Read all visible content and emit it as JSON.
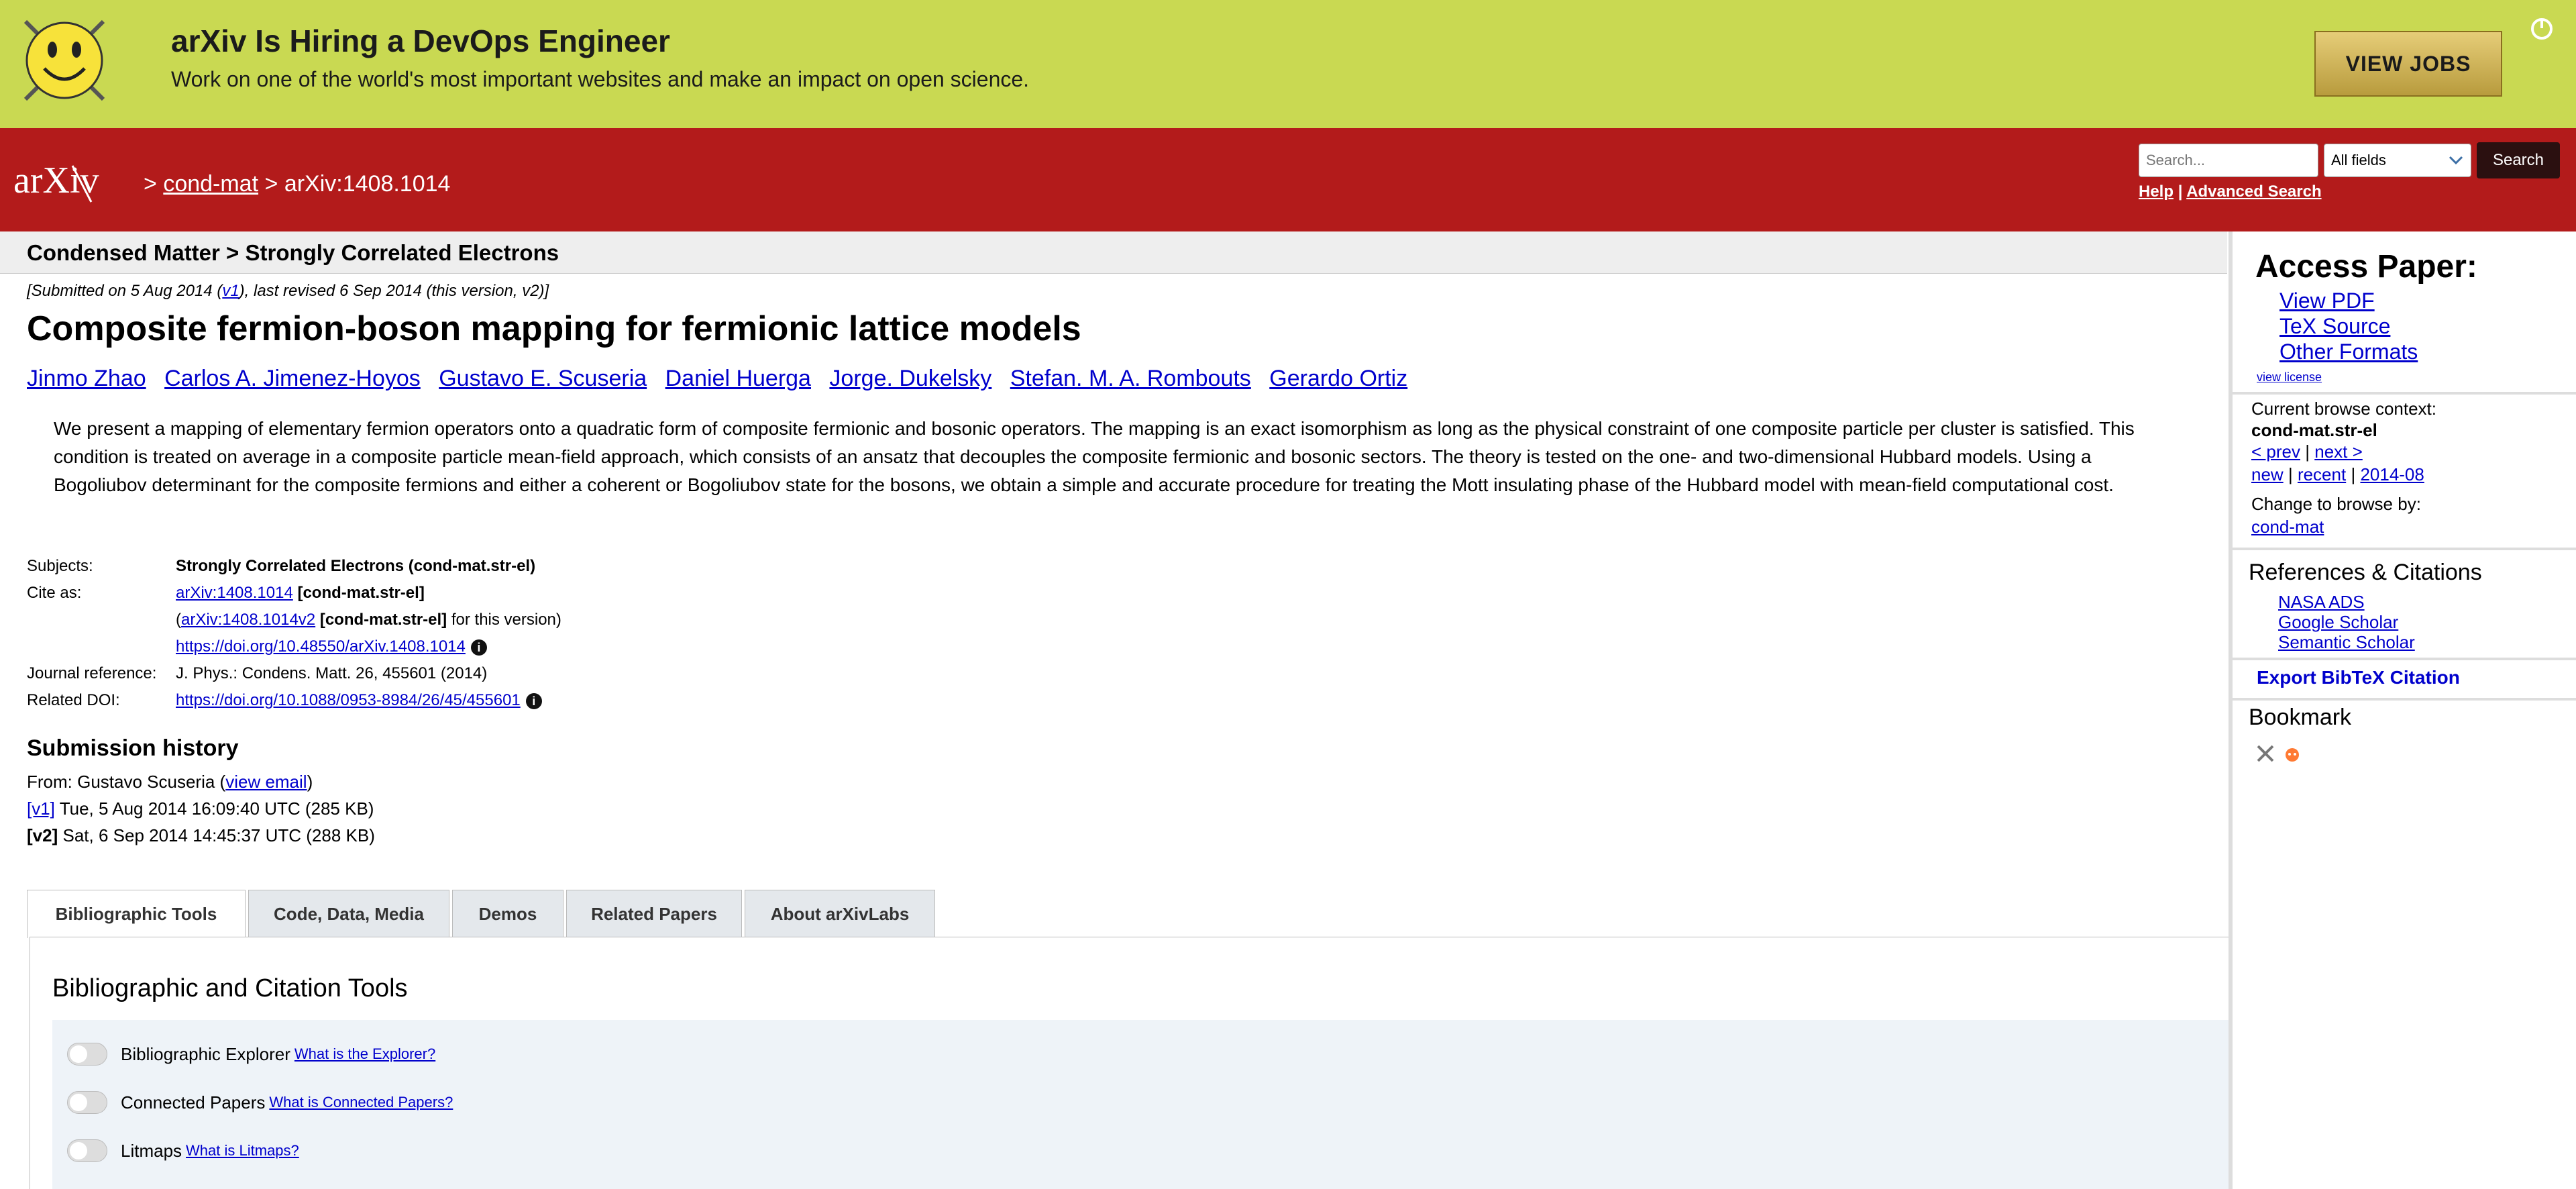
{
  "banner": {
    "title": "arXiv Is Hiring a DevOps Engineer",
    "subtitle": "Work on one of the world's most important websites and make an impact on open science.",
    "cta_label": "VIEW JOBS",
    "colors": {
      "background": "#c9d952",
      "button": "#d2b45a"
    }
  },
  "header": {
    "logo_text": "arXiv",
    "breadcrumb_sep": ">",
    "breadcrumb_category": "cond-mat",
    "breadcrumb_id": "arXiv:1408.1014",
    "search_placeholder": "Search...",
    "search_field_selected": "All fields",
    "search_button": "Search",
    "help_label": "Help",
    "help_sep": "|",
    "advanced_label": "Advanced Search",
    "colors": {
      "background": "#b31b1b"
    }
  },
  "paper": {
    "subject_header": "Condensed Matter > Strongly Correlated Electrons",
    "dateline_prefix": "[Submitted on 5 Aug 2014 (",
    "dateline_version": "v1",
    "dateline_suffix": "), last revised 6 Sep 2014 (this version, v2)]",
    "title": "Composite fermion-boson mapping for fermionic lattice models",
    "authors": [
      "Jinmo Zhao",
      "Carlos A. Jimenez-Hoyos",
      "Gustavo E. Scuseria",
      "Daniel Huerga",
      "Jorge. Dukelsky",
      "Stefan. M. A. Rombouts",
      "Gerardo Ortiz"
    ],
    "abstract": "We present a mapping of elementary fermion operators onto a quadratic form of composite fermionic and bosonic operators. The mapping is an exact isomorphism as long as the physical constraint of one composite particle per cluster is satisfied. This condition is treated on average in a composite particle mean-field approach, which consists of an ansatz that decouples the composite fermionic and bosonic sectors. The theory is tested on the one- and two-dimensional Hubbard models. Using a Bogoliubov determinant for the composite fermions and either a coherent or Bogoliubov state for the bosons, we obtain a simple and accurate procedure for treating the Mott insulating phase of the Hubbard model with mean-field computational cost."
  },
  "metadata": {
    "subjects_label": "Subjects:",
    "subjects_value": "Strongly Correlated Electrons (cond-mat.str-el)",
    "cite_label": "Cite as:",
    "cite_link": "arXiv:1408.1014",
    "cite_tag": "[cond-mat.str-el]",
    "cite_label2": "",
    "cite_link2": "arXiv:1408.1014v2",
    "cite_tag2": "[cond-mat.str-el]",
    "cite_suffix2": "for this version)",
    "doi_link": "https://doi.org/10.48550/arXiv.1408.1014",
    "journal_label": "Journal reference:",
    "journal_value": "J. Phys.: Condens. Matt. 26, 455601 (2014)",
    "related_doi_label": "Related DOI:",
    "related_doi_link": "https://doi.org/10.1088/0953-8984/26/45/455601",
    "info_glyph": "i"
  },
  "history": {
    "title": "Submission history",
    "from_text": "From: Gustavo Scuseria (",
    "view_email": "view email",
    "from_close": ")",
    "v1_link": "[v1]",
    "v1_text": "Tue, 5 Aug 2014 16:09:40 UTC (285 KB)",
    "v2_label": "[v2]",
    "v2_text": "Sat, 6 Sep 2014 14:45:37 UTC (288 KB)"
  },
  "tabs": [
    "Bibliographic Tools",
    "Code, Data, Media",
    "Demos",
    "Related Papers",
    "About arXivLabs"
  ],
  "panel": {
    "title": "Bibliographic and Citation Tools",
    "tools": [
      {
        "label": "Bibliographic Explorer",
        "help": "What is the Explorer?"
      },
      {
        "label": "Connected Papers",
        "help": "What is Connected Papers?"
      },
      {
        "label": "Litmaps",
        "help": "What is Litmaps?"
      }
    ]
  },
  "sidebar": {
    "access_heading": "Access Paper:",
    "view_pdf": "View PDF",
    "tex_source": "TeX Source",
    "other_formats": "Other Formats",
    "view_license": "view license",
    "context_label": "Current browse context:",
    "context_value": "cond-mat.str-el",
    "prev": "< prev",
    "sep": "|",
    "next": "next >",
    "new": "new",
    "recent": "recent",
    "month": "2014-08",
    "change_label": "Change to browse by:",
    "change_value": "cond-mat",
    "refs_heading": "References & Citations",
    "nasa_ads": "NASA ADS",
    "google_scholar": "Google Scholar",
    "semantic_scholar": "Semantic Scholar",
    "export_bibtex": "Export BibTeX Citation",
    "bookmark_heading": "Bookmark"
  }
}
